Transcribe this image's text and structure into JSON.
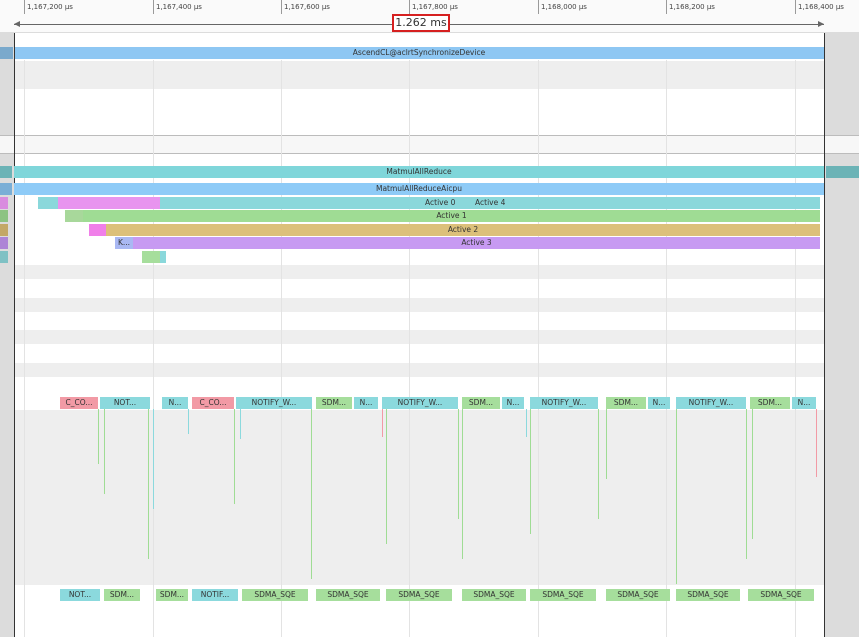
{
  "ruler": {
    "ticks": [
      "1,167,200 µs",
      "1,167,400 µs",
      "1,167,600 µs",
      "1,167,800 µs",
      "1,168,000 µs",
      "1,168,200 µs",
      "1,168,400 µs"
    ],
    "selection_duration": "1.262 ms"
  },
  "tracks": {
    "host": {
      "label": "AscendCL@aclrtSynchronizeDevice"
    },
    "op": {
      "label": "MatmulAllReduce"
    },
    "aicpu": {
      "label": "MatmulAllReduceAicpu"
    },
    "active0": "Active 0",
    "active4": "Active 4",
    "active1": "Active 1",
    "active2": "Active 2",
    "active3": "Active 3",
    "k_short": "K...",
    "notify_row": [
      "C_CO...",
      "NOT...",
      "N...",
      "C_CO...",
      "NOTIFY_W...",
      "SDM...",
      "N...",
      "NOTIFY_W...",
      "SDM...",
      "N...",
      "NOTIFY_W...",
      "SDM...",
      "N...",
      "NOTIFY_W...",
      "SDM...",
      "N..."
    ],
    "sdma_row": [
      "NOT...",
      "SDM...",
      "SDM...",
      "NOTIF...",
      "SDMA_SQE",
      "SDMA_SQE",
      "SDMA_SQE",
      "SDMA_SQE",
      "SDMA_SQE",
      "SDMA_SQE",
      "SDMA_SQE",
      "SDMA_SQE"
    ]
  },
  "colors": {
    "host": "#8ec7f3",
    "op": "#7fd6da",
    "aicpu": "#8ecbf7",
    "active_teal": "#8ad8db",
    "active_pink": "#e894ef",
    "active_green": "#9fdc94",
    "active_orange": "#dcc07a",
    "active_purple": "#c79af2",
    "notify_pink": "#f29aa5",
    "notify_teal": "#8bd9dd",
    "sdma_green": "#a6de9c",
    "highlight": "#d62020"
  }
}
